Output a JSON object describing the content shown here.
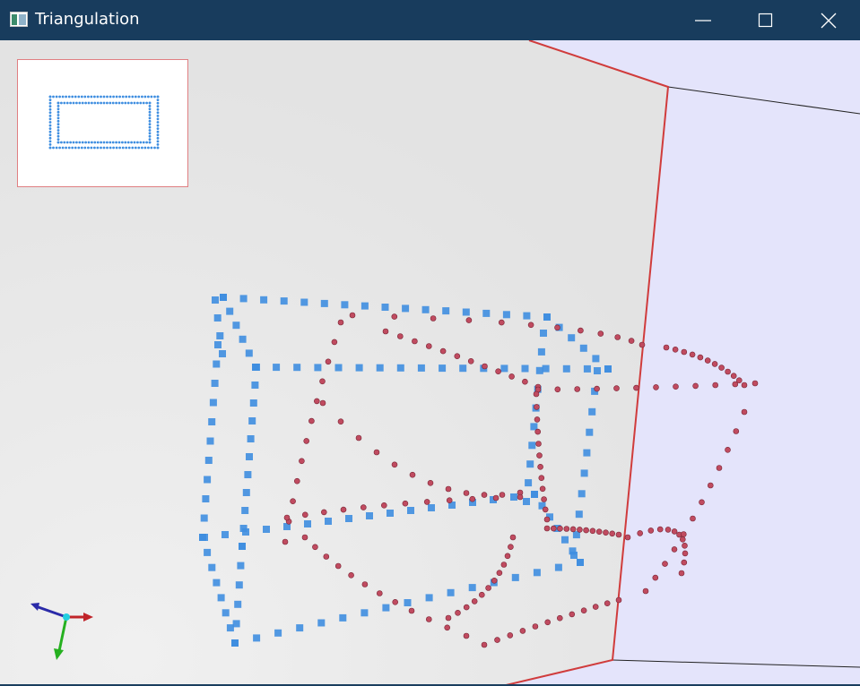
{
  "window": {
    "title": "Triangulation",
    "icon": "app-window-icon",
    "controls": {
      "minimize_icon": "minimize-icon",
      "maximize_icon": "maximize-icon",
      "close_icon": "close-icon"
    }
  },
  "scene": {
    "image_plane_color": "#e4e4e4",
    "side_plane_color": "#e4e4fb",
    "plane_edge_color": "#d03c3c",
    "pattern_marker_color": "#3f8ee0",
    "triangulated_point_color": "#c04b60"
  },
  "thumbnail": {
    "marker_color": "#3f8ee0"
  },
  "axes": {
    "x_color": "#c0242a",
    "y_color": "#25b01f",
    "z_color": "#2a2aa8",
    "origin_color": "#22d0e0"
  }
}
